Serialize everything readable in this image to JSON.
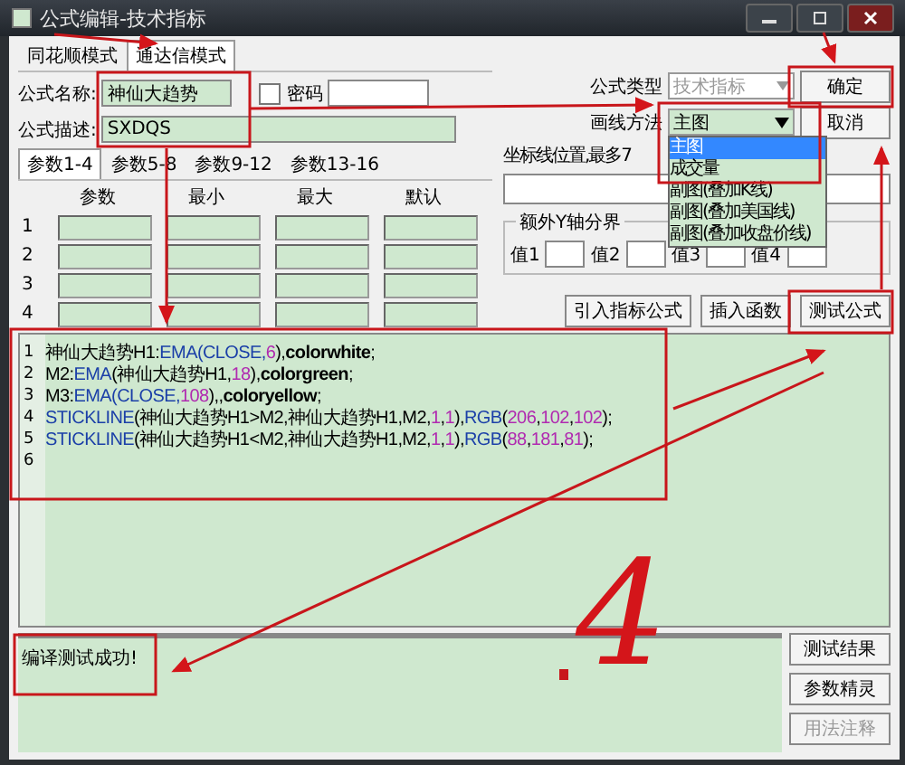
{
  "window": {
    "title": "公式编辑-技术指标"
  },
  "mode_tabs": [
    {
      "label": "同花顺模式",
      "selected": false
    },
    {
      "label": "通达信模式",
      "selected": true
    }
  ],
  "formula_name": {
    "label": "公式名称:",
    "value": "神仙大趋势"
  },
  "password": {
    "label": "密码",
    "checked": false
  },
  "formula_desc": {
    "label": "公式描述:",
    "value": "SXDQS"
  },
  "param_tabs": [
    {
      "label": "参数1-4",
      "selected": true
    },
    {
      "label": "参数5-8",
      "selected": false
    },
    {
      "label": "参数9-12",
      "selected": false
    },
    {
      "label": "参数13-16",
      "selected": false
    }
  ],
  "param_table": {
    "columns": [
      "参数",
      "最小",
      "最大",
      "默认"
    ],
    "rows": [
      "1",
      "2",
      "3",
      "4"
    ]
  },
  "formula_type": {
    "label": "公式类型",
    "value": "技术指标",
    "disabled": true
  },
  "draw_method": {
    "label": "画线方法",
    "value": "主图",
    "options": [
      {
        "label": "主图",
        "selected": true
      },
      {
        "label": "成交量",
        "selected": false
      },
      {
        "label": "副图(叠加K线)",
        "selected": false
      },
      {
        "label": "副图(叠加美国线)",
        "selected": false
      },
      {
        "label": "副图(叠加收盘价线)",
        "selected": false
      }
    ]
  },
  "confirm_button": "确定",
  "cancel_button": "取消",
  "axis_label": "坐标线位置,最多7",
  "y_axis_group": {
    "title": "额外Y轴分界",
    "fields": [
      "值1",
      "值2",
      "值3",
      "值4"
    ]
  },
  "action_buttons": [
    "引入指标公式",
    "插入函数",
    "测试公式"
  ],
  "editor": {
    "lines": [
      {
        "number": "1",
        "tokens": [
          {
            "kind": "plain",
            "text": "神仙大趋势H1:"
          },
          {
            "kind": "func",
            "text": "EMA(CLOSE,"
          },
          {
            "kind": "num",
            "text": "6"
          },
          {
            "kind": "plain",
            "text": "),"
          },
          {
            "kind": "keyword",
            "text": "colorwhite"
          },
          {
            "kind": "plain",
            "text": ";"
          }
        ]
      },
      {
        "number": "2",
        "tokens": [
          {
            "kind": "plain",
            "text": "M2:"
          },
          {
            "kind": "func",
            "text": "EMA"
          },
          {
            "kind": "plain",
            "text": "(神仙大趋势H1,"
          },
          {
            "kind": "num",
            "text": "18"
          },
          {
            "kind": "plain",
            "text": "),"
          },
          {
            "kind": "keyword",
            "text": "colorgreen"
          },
          {
            "kind": "plain",
            "text": ";"
          }
        ]
      },
      {
        "number": "3",
        "tokens": [
          {
            "kind": "plain",
            "text": "M3:"
          },
          {
            "kind": "func",
            "text": "EMA(CLOSE,"
          },
          {
            "kind": "num",
            "text": "108"
          },
          {
            "kind": "plain",
            "text": "),,"
          },
          {
            "kind": "keyword",
            "text": "coloryellow"
          },
          {
            "kind": "plain",
            "text": ";"
          }
        ]
      },
      {
        "number": "4",
        "tokens": [
          {
            "kind": "func",
            "text": "STICKLINE"
          },
          {
            "kind": "plain",
            "text": "(神仙大趋势H1>M2,神仙大趋势H1,M2,"
          },
          {
            "kind": "num",
            "text": "1"
          },
          {
            "kind": "plain",
            "text": ","
          },
          {
            "kind": "num",
            "text": "1"
          },
          {
            "kind": "plain",
            "text": "),"
          },
          {
            "kind": "func",
            "text": "RGB"
          },
          {
            "kind": "plain",
            "text": "("
          },
          {
            "kind": "num",
            "text": "206"
          },
          {
            "kind": "plain",
            "text": ","
          },
          {
            "kind": "num",
            "text": "102"
          },
          {
            "kind": "plain",
            "text": ","
          },
          {
            "kind": "num",
            "text": "102"
          },
          {
            "kind": "plain",
            "text": ");"
          }
        ]
      },
      {
        "number": "5",
        "tokens": [
          {
            "kind": "func",
            "text": "STICKLINE"
          },
          {
            "kind": "plain",
            "text": "(神仙大趋势H1<M2,神仙大趋势H1,M2,"
          },
          {
            "kind": "num",
            "text": "1"
          },
          {
            "kind": "plain",
            "text": ","
          },
          {
            "kind": "num",
            "text": "1"
          },
          {
            "kind": "plain",
            "text": "),"
          },
          {
            "kind": "func",
            "text": "RGB"
          },
          {
            "kind": "plain",
            "text": "("
          },
          {
            "kind": "num",
            "text": "88"
          },
          {
            "kind": "plain",
            "text": ","
          },
          {
            "kind": "num",
            "text": "181"
          },
          {
            "kind": "plain",
            "text": ","
          },
          {
            "kind": "num",
            "text": "81"
          },
          {
            "kind": "plain",
            "text": ");"
          }
        ]
      },
      {
        "number": "6"
      }
    ]
  },
  "message": "编译测试成功!",
  "side_buttons": [
    {
      "label": "测试结果",
      "disabled": false
    },
    {
      "label": "参数精灵",
      "disabled": false
    },
    {
      "label": "用法注释",
      "disabled": true
    }
  ],
  "annotation": {
    "text": "4"
  }
}
